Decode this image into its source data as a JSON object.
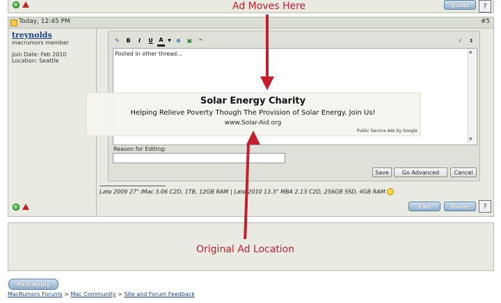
{
  "annotations": {
    "top": "Ad Moves Here",
    "bottom": "Original Ad Location"
  },
  "post": {
    "timestamp": "Today, 12:45 PM",
    "number": "#5",
    "username": "treynolds",
    "usertitle": "macrumors member",
    "join_date": "Join Date: Feb 2010",
    "location": "Location: Seattle",
    "message": "Posted in other thread...",
    "reason_label": "Reason for Editing:",
    "reason_value": "",
    "signature": "Late 2009 27\" iMac 3.06 C2D, 1TB, 12GB RAM | Late 2010 13.3\" MBA 2.13 C2D, 256GB SSD, 4GB RAM"
  },
  "editor": {
    "toolbar": [
      "B",
      "I",
      "U",
      "A"
    ],
    "save_label": "Save",
    "go_advanced_label": "Go Advanced",
    "cancel_label": "Cancel"
  },
  "ad": {
    "title": "Solar Energy Charity",
    "line": "Helping Relieve Poverty Though The Provision of Solar Energy. Join Us!",
    "url": "www.Solar-Aid.org",
    "footer": "Public Service Ads by Google"
  },
  "buttons": {
    "quote": "Quote",
    "edit": "Edit",
    "post_reply": "Post Reply"
  },
  "breadcrumb": {
    "items": [
      "MacRumors Forums",
      "Mac Community",
      "Site and Forum Feedback"
    ],
    "separator": ">"
  },
  "colors": {
    "accent_red": "#c31f2c",
    "panel_bg": "#e9eae2",
    "header_bg": "#d8dfd2"
  }
}
